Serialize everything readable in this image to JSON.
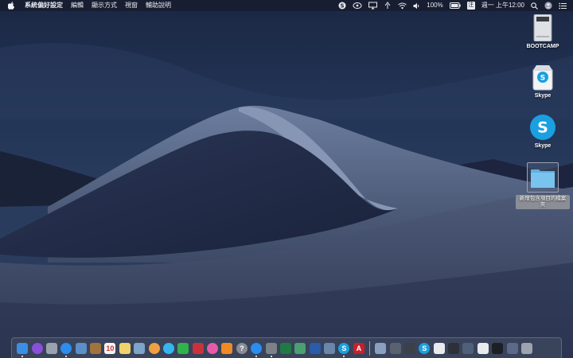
{
  "menubar": {
    "app_name": "系統偏好設定",
    "menus": [
      "編輯",
      "顯示方式",
      "視窗",
      "輔助說明"
    ],
    "status": {
      "input_method": "注",
      "battery_percent": "100%",
      "datetime": "週一 上午12:00"
    }
  },
  "desktop": {
    "icons": [
      {
        "label": "BOOTCAMP",
        "icon": "drive-icon"
      },
      {
        "label": "Skype",
        "icon": "skype-installer-icon"
      },
      {
        "label": "Skype",
        "icon": "skype-app-icon"
      },
      {
        "label": "新增包含項目的檔案夾",
        "icon": "folder-icon",
        "selected": true
      }
    ]
  },
  "dock": {
    "apps": [
      {
        "name": "finder-icon",
        "color": "#3a8ee6"
      },
      {
        "name": "siri-icon",
        "color": "#8a4fd8"
      },
      {
        "name": "launchpad-icon",
        "color": "#9aa3ad"
      },
      {
        "name": "safari-icon",
        "color": "#2d8cf0"
      },
      {
        "name": "preview-icon",
        "color": "#5b8fc7"
      },
      {
        "name": "notebook-icon",
        "color": "#a0743c"
      },
      {
        "name": "calendar-icon",
        "color": "#f4f4f4",
        "text": "10"
      },
      {
        "name": "notes-icon",
        "color": "#f1d36b"
      },
      {
        "name": "photos-preview-icon",
        "color": "#7da4c9"
      },
      {
        "name": "photos-icon",
        "color": "#f0a040"
      },
      {
        "name": "messages-icon",
        "color": "#36b4f0"
      },
      {
        "name": "facetime-icon",
        "color": "#2fb34a"
      },
      {
        "name": "photo-booth-icon",
        "color": "#c8323a"
      },
      {
        "name": "itunes-icon",
        "color": "#e85aa8"
      },
      {
        "name": "ibooks-icon",
        "color": "#f08a24"
      },
      {
        "name": "help-icon",
        "color": "#888c94",
        "text": "?"
      },
      {
        "name": "app-store-icon",
        "color": "#2a8ef0"
      },
      {
        "name": "system-preferences-icon",
        "color": "#7c8288"
      },
      {
        "name": "excel-icon",
        "color": "#1f7a44"
      },
      {
        "name": "network-icon",
        "color": "#4aa070"
      },
      {
        "name": "word-icon",
        "color": "#2b5caa"
      },
      {
        "name": "utility-icon",
        "color": "#6a86a8"
      },
      {
        "name": "skype-icon",
        "color": "#1aa0e0",
        "text": "S"
      },
      {
        "name": "acrobat-icon",
        "color": "#c8202a",
        "text": "A"
      }
    ],
    "others": [
      {
        "name": "screenshot-icon",
        "color": "#8aa0c0"
      },
      {
        "name": "network-utility-icon",
        "color": "#5a6270"
      },
      {
        "name": "activity-icon",
        "color": "#3c4048"
      },
      {
        "name": "skype-icon-2",
        "color": "#1aa0e0",
        "text": "S"
      },
      {
        "name": "document-icon",
        "color": "#e8eaee"
      },
      {
        "name": "window-icon",
        "color": "#2c3038"
      },
      {
        "name": "image-icon",
        "color": "#50607a"
      },
      {
        "name": "text-file-icon",
        "color": "#e8eaee"
      },
      {
        "name": "terminal-icon",
        "color": "#1c2026"
      },
      {
        "name": "screen-icon",
        "color": "#5a6a88"
      },
      {
        "name": "trash-icon",
        "color": "#9ea4ae"
      }
    ]
  }
}
